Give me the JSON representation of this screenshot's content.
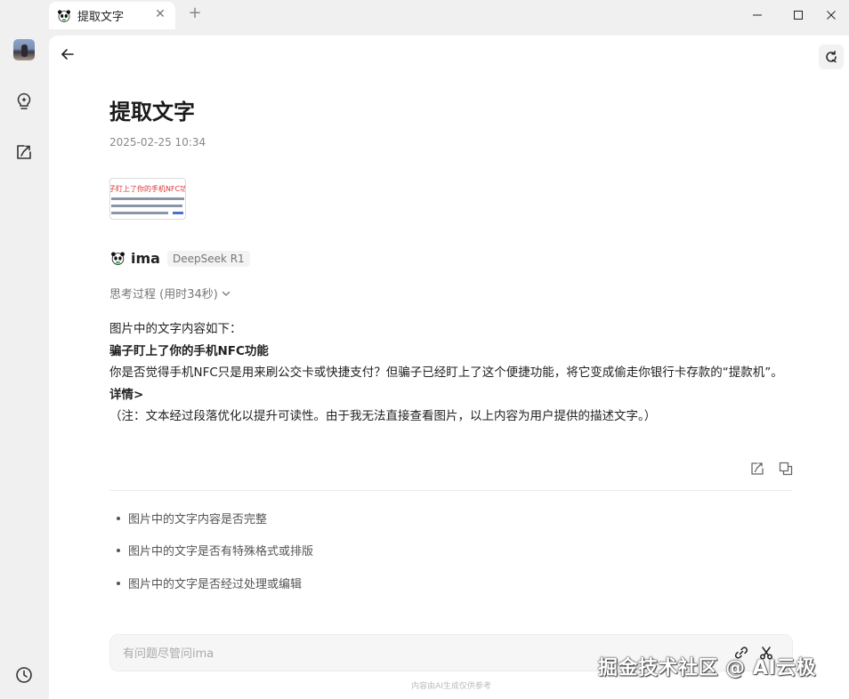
{
  "tab": {
    "title": "提取文字"
  },
  "main": {
    "title": "提取文字",
    "time": "2025-02-25 10:34",
    "bot": {
      "name": "ima",
      "model": "DeepSeek R1"
    },
    "thinking": "思考过程 (用时34秒)",
    "answer": {
      "intro": "图片中的文字内容如下：",
      "heading": "骗子盯上了你的手机NFC功能",
      "body": "你是否觉得手机NFC只是用来刷公交卡或快捷支付？但骗子已经盯上了这个便捷功能，将它变成偷走你银行卡存款的“提款机”。",
      "details": "详情>",
      "note": "（注：文本经过段落优化以提升可读性。由于我无法直接查看图片，以上内容为用户提供的描述文字。）"
    },
    "suggestions": [
      "图片中的文字内容是否完整",
      "图片中的文字是否有特殊格式或排版",
      "图片中的文字是否经过处理或编辑"
    ],
    "input": {
      "placeholder": "有问题尽管问ima"
    },
    "disclaimer": "内容由AI生成仅供参考"
  },
  "thumbnail": {
    "text": "子盯上了你的手机NFC功能"
  },
  "watermark": "掘金技术社区 @ AI云极"
}
